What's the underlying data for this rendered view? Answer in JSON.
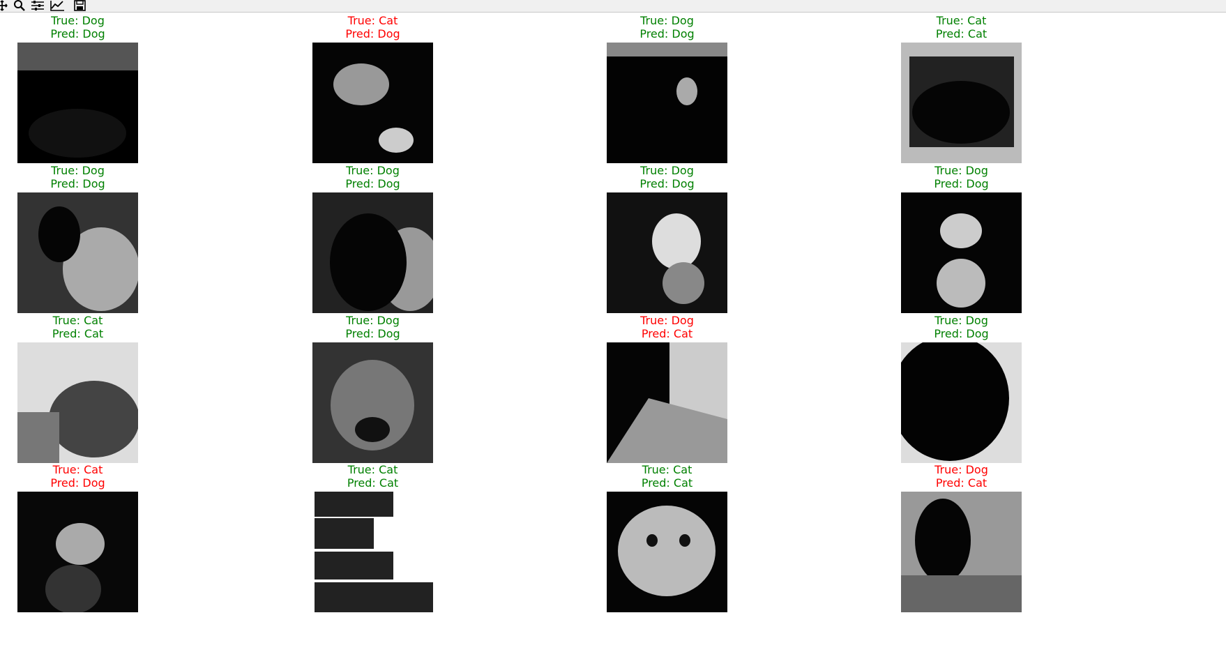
{
  "toolbar": {
    "icons": [
      "move-icon",
      "zoom-icon",
      "configure-subplots-icon",
      "edit-axes-icon",
      "save-icon"
    ]
  },
  "colors": {
    "correct": "#008000",
    "incorrect": "#ff0000",
    "toolbar_bg": "#f0f0f0"
  },
  "grid": {
    "cells": [
      {
        "true_label": "True: Dog",
        "pred_label": "Pred: Dog",
        "correct": true
      },
      {
        "true_label": "True: Cat",
        "pred_label": "Pred: Dog",
        "correct": false
      },
      {
        "true_label": "True: Dog",
        "pred_label": "Pred: Dog",
        "correct": true
      },
      {
        "true_label": "True: Cat",
        "pred_label": "Pred: Cat",
        "correct": true
      },
      {
        "true_label": "True: Dog",
        "pred_label": "Pred: Dog",
        "correct": true
      },
      {
        "true_label": "True: Dog",
        "pred_label": "Pred: Dog",
        "correct": true
      },
      {
        "true_label": "True: Dog",
        "pred_label": "Pred: Dog",
        "correct": true
      },
      {
        "true_label": "True: Dog",
        "pred_label": "Pred: Dog",
        "correct": true
      },
      {
        "true_label": "True: Cat",
        "pred_label": "Pred: Cat",
        "correct": true
      },
      {
        "true_label": "True: Dog",
        "pred_label": "Pred: Dog",
        "correct": true
      },
      {
        "true_label": "True: Dog",
        "pred_label": "Pred: Cat",
        "correct": false
      },
      {
        "true_label": "True: Dog",
        "pred_label": "Pred: Dog",
        "correct": true
      },
      {
        "true_label": "True: Cat",
        "pred_label": "Pred: Dog",
        "correct": false
      },
      {
        "true_label": "True: Cat",
        "pred_label": "Pred: Cat",
        "correct": true
      },
      {
        "true_label": "True: Cat",
        "pred_label": "Pred: Cat",
        "correct": true
      },
      {
        "true_label": "True: Dog",
        "pred_label": "Pred: Cat",
        "correct": false
      }
    ]
  }
}
